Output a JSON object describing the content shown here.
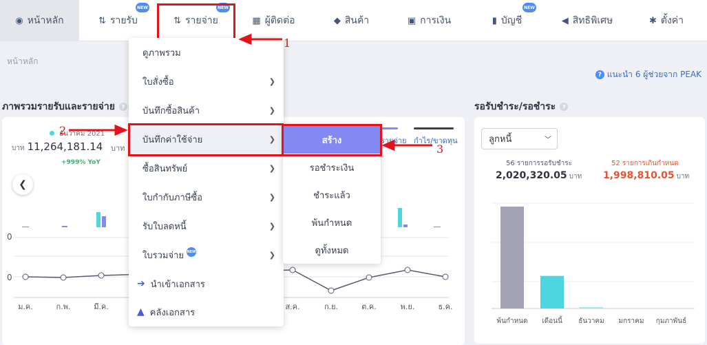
{
  "nav": {
    "items": [
      {
        "label": "หน้าหลัก",
        "icon": "dashboard-icon",
        "new": false
      },
      {
        "label": "รายรับ",
        "icon": "income-icon",
        "new": true
      },
      {
        "label": "รายจ่าย",
        "icon": "expense-icon",
        "new": true
      },
      {
        "label": "ผู้ติดต่อ",
        "icon": "contacts-icon",
        "new": false
      },
      {
        "label": "สินค้า",
        "icon": "product-box-icon",
        "new": false
      },
      {
        "label": "การเงิน",
        "icon": "money-icon",
        "new": false
      },
      {
        "label": "บัญชี",
        "icon": "accounting-icon",
        "new": true
      },
      {
        "label": "สิทธิพิเศษ",
        "icon": "megaphone-icon",
        "new": false
      },
      {
        "label": "ตั้งค่า",
        "icon": "gear-icon",
        "new": false
      }
    ],
    "new_badge": "NEW"
  },
  "breadcrumb": "หน้าหลัก",
  "help_text": "แนะนำ 6 ผู้ช่วยจาก PEAK",
  "overview": {
    "title": "ภาพรวมรายรับและรายจ่าย",
    "date_label": "ธันวาคม 2021",
    "unit": "บาท",
    "amount": "11,264,181.14",
    "yoy": "+999% YoY",
    "amount_b_prefix": "บาท 1",
    "legend": [
      {
        "label": "รายจ่าย",
        "color": "#8389f2"
      },
      {
        "label": "กำไร/ขาดทุน",
        "color": "#3b3f5c"
      }
    ],
    "months": [
      "ม.ค.",
      "ก.พ.",
      "มี.ค.",
      "ส.ค.",
      "ก.ย.",
      "ต.ค.",
      "พ.ย.",
      "ธ.ค."
    ],
    "y_tick_upper": "0",
    "y_tick_lower": "0"
  },
  "expense_menu": {
    "items": [
      {
        "label": "ดูภาพรวม",
        "has_sub": false
      },
      {
        "label": "ใบสั่งซื้อ",
        "has_sub": true
      },
      {
        "label": "บันทึกซื้อสินค้า",
        "has_sub": true
      },
      {
        "label": "บันทึกค่าใช้จ่าย",
        "has_sub": true
      },
      {
        "label": "ซื้อสินทรัพย์",
        "has_sub": true
      },
      {
        "label": "ใบกำกับภาษีซื้อ",
        "has_sub": true
      },
      {
        "label": "รับใบลดหนี้",
        "has_sub": true
      },
      {
        "label": "ใบรวมจ่าย",
        "has_sub": true
      },
      {
        "label": "นำเข้าเอกสาร",
        "has_sub": false
      },
      {
        "label": "คลังเอกสาร",
        "has_sub": false
      }
    ]
  },
  "expense_submenu": {
    "items": [
      "สร้าง",
      "รอชำระเงิน",
      "ชำระแล้ว",
      "พ้นกำหนด",
      "ดูทั้งหมด"
    ]
  },
  "annotations": {
    "n1": "1",
    "n2": "2",
    "n3": "3"
  },
  "receivables": {
    "title": "รอรับชำระ/รอชำระ",
    "select_value": "ลูกหนี้",
    "pending_label": "56 รายการรอรับชำระ",
    "pending_amount": "2,020,320.05",
    "overdue_label": "52 รายการเกินกำหนด",
    "overdue_amount": "1,998,810.05",
    "unit": "บาท",
    "bar_labels": [
      "พ้นกำหนด",
      "เดือนนี้",
      "ธันวาคม",
      "มกราคม",
      "กุมภาพันธ์"
    ],
    "pending_color": "#555b6e",
    "overdue_color": "#e8532f"
  },
  "chart_data": {
    "type": "bar",
    "categories": [
      "พ้นกำหนด",
      "เดือนนี้",
      "ธันวาคม",
      "มกราคม",
      "กุมภาพันธ์"
    ],
    "values": [
      100,
      32,
      1,
      0,
      0
    ],
    "colors": [
      "#a3a3b5",
      "#4ed6e0",
      "#9ee7ee",
      "#d8dbe3",
      "#d8dbe3"
    ],
    "ylim": [
      0,
      100
    ]
  }
}
